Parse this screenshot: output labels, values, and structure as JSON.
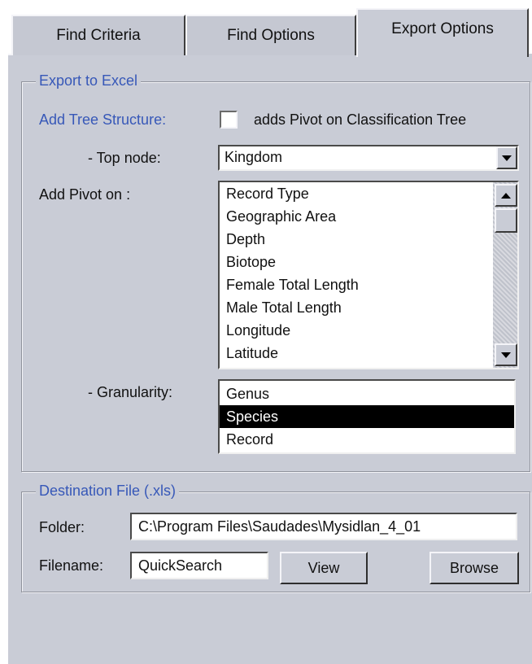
{
  "tabs": [
    {
      "label": "Find Criteria"
    },
    {
      "label": "Find Options"
    },
    {
      "label": "Export Options"
    }
  ],
  "export_group": {
    "title": "Export to Excel",
    "add_tree_label": "Add Tree Structure:",
    "checkbox_label": "adds Pivot on Classification Tree",
    "top_node_label": "- Top node:",
    "top_node_value": "Kingdom",
    "add_pivot_label": "Add Pivot on :",
    "pivot_items": [
      "Record Type",
      "Geographic Area",
      "Depth",
      "Biotope",
      "Female Total Length",
      "Male Total Length",
      "Longitude",
      "Latitude"
    ],
    "granularity_label": "- Granularity:",
    "granularity_items": [
      "Genus",
      "Species",
      "Record"
    ],
    "granularity_selected": "Species"
  },
  "destination_group": {
    "title": "Destination File (.xls)",
    "folder_label": "Folder:",
    "folder_value": "C:\\Program Files\\Saudades\\Mysidlan_4_01",
    "filename_label": "Filename:",
    "filename_value": "QuickSearch",
    "view_label": "View",
    "browse_label": "Browse"
  },
  "colors": {
    "group_title": "#3758b8",
    "panel": "#c9ccd6"
  }
}
